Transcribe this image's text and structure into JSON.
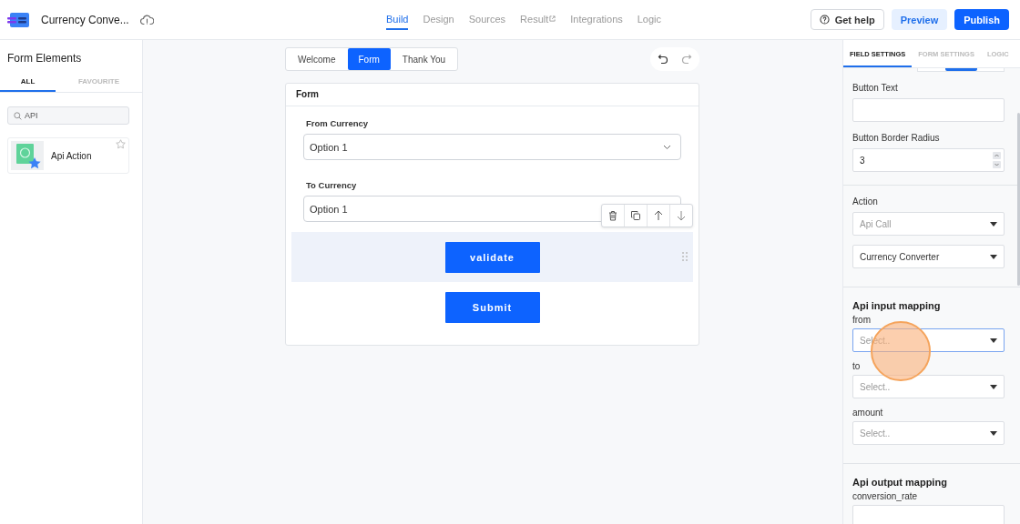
{
  "app": {
    "title": "Currency Conve..."
  },
  "nav": [
    {
      "label": "Build",
      "selected": true,
      "external": false
    },
    {
      "label": "Design",
      "selected": false,
      "external": false
    },
    {
      "label": "Sources",
      "selected": false,
      "external": false
    },
    {
      "label": "Result",
      "selected": false,
      "external": true
    },
    {
      "label": "Integrations",
      "selected": false,
      "external": false
    },
    {
      "label": "Logic",
      "selected": false,
      "external": false
    }
  ],
  "actions": [
    {
      "label": "Get help",
      "kind": "help"
    },
    {
      "label": "Preview",
      "kind": "secondary"
    },
    {
      "label": "Publish",
      "kind": "primary"
    }
  ],
  "sidebar": {
    "title": "Form Elements",
    "tabs": [
      {
        "label": "ALL",
        "selected": true
      },
      {
        "label": "FAVOURITE",
        "selected": false
      }
    ],
    "search": {
      "value": "API"
    },
    "elements": [
      {
        "label": "Api Action",
        "favourite": false
      }
    ]
  },
  "canvas": {
    "pages": [
      {
        "label": "Welcome",
        "selected": false
      },
      {
        "label": "Form",
        "selected": true
      },
      {
        "label": "Thank You",
        "selected": false
      }
    ],
    "form": {
      "title": "Form",
      "fields": [
        {
          "label": "From Currency",
          "value": "Option 1"
        },
        {
          "label": "To Currency",
          "value": "Option 1"
        }
      ],
      "buttons": [
        {
          "label": "validate",
          "selected": true
        },
        {
          "label": "Submit",
          "selected": false
        }
      ]
    }
  },
  "settings": {
    "tabs": [
      {
        "label": "FIELD SETTINGS",
        "selected": true
      },
      {
        "label": "FORM SETTINGS",
        "selected": false
      },
      {
        "label": "LOGIC",
        "selected": false
      }
    ],
    "button_text": {
      "label": "Button Text"
    },
    "border_radius": {
      "label": "Button Border Radius",
      "value": "3"
    },
    "action": {
      "label": "Action",
      "selects": [
        {
          "value": "Api Call",
          "disabled": true
        },
        {
          "value": "Currency Converter",
          "disabled": false
        }
      ]
    },
    "input_mapping": {
      "title": "Api input mapping",
      "fields": [
        {
          "label": "from",
          "placeholder": "Select..",
          "focused": true
        },
        {
          "label": "to",
          "placeholder": "Select..",
          "focused": false
        },
        {
          "label": "amount",
          "placeholder": "Select..",
          "focused": false
        }
      ]
    },
    "output_mapping": {
      "title": "Api output mapping",
      "fields": [
        {
          "label": "conversion_rate"
        }
      ]
    }
  }
}
